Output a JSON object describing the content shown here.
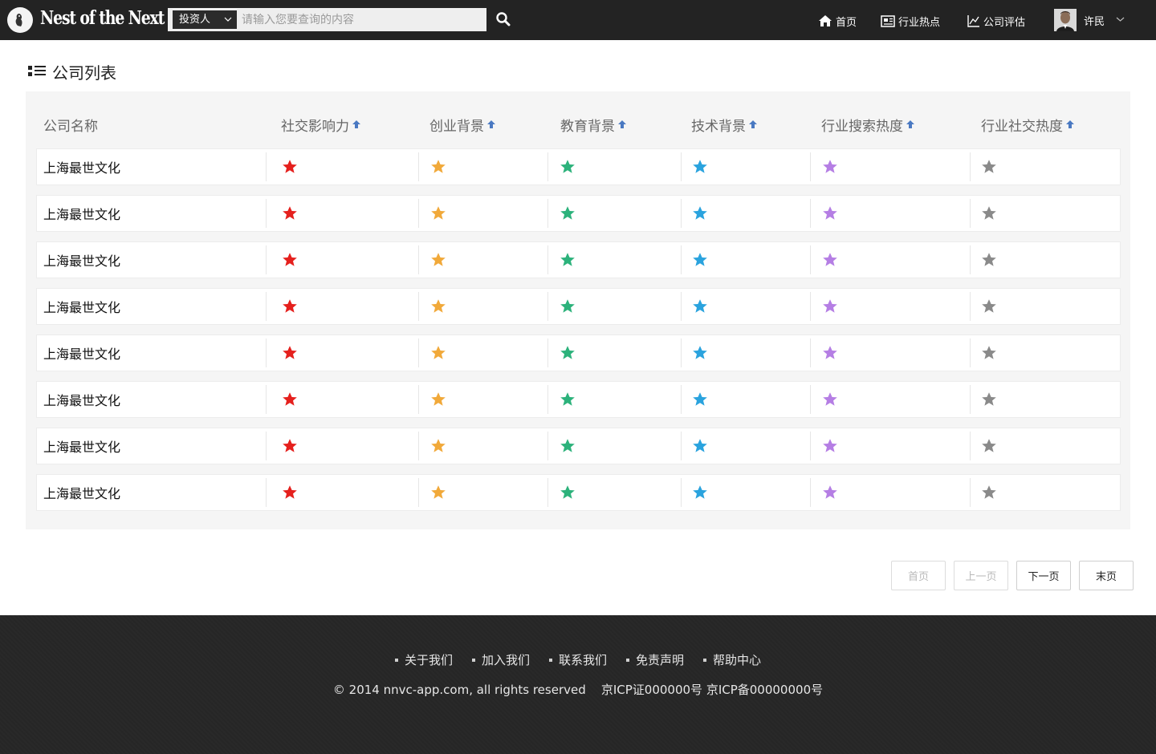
{
  "header": {
    "logo_text": "Nest of the Next",
    "search": {
      "category": "投资人",
      "placeholder": "请输入您要查询的内容"
    },
    "nav": {
      "home": "首页",
      "industry_hot": "行业热点",
      "company_eval": "公司评估"
    },
    "user": {
      "name": "许民"
    }
  },
  "section": {
    "title": "公司列表"
  },
  "table": {
    "columns": [
      "公司名称",
      "社交影响力",
      "创业背景",
      "教育背景",
      "技术背景",
      "行业搜索热度",
      "行业社交热度"
    ],
    "star_colors": [
      "#e5201d",
      "#f1a93a",
      "#2cb27b",
      "#2aa3de",
      "#b57ee4",
      "#8a8a8a"
    ],
    "rows": [
      {
        "name": "上海最世文化"
      },
      {
        "name": "上海最世文化"
      },
      {
        "name": "上海最世文化"
      },
      {
        "name": "上海最世文化"
      },
      {
        "name": "上海最世文化"
      },
      {
        "name": "上海最世文化"
      },
      {
        "name": "上海最世文化"
      },
      {
        "name": "上海最世文化"
      }
    ]
  },
  "pagination": {
    "first": "首页",
    "prev": "上一页",
    "next": "下一页",
    "last": "末页"
  },
  "footer": {
    "links": [
      "关于我们",
      "加入我们",
      "联系我们",
      "免责声明",
      "帮助中心"
    ],
    "copyright": "© 2014 nnvc-app.com, all rights reserved",
    "icp": "京ICP证000000号 京ICP备00000000号"
  }
}
